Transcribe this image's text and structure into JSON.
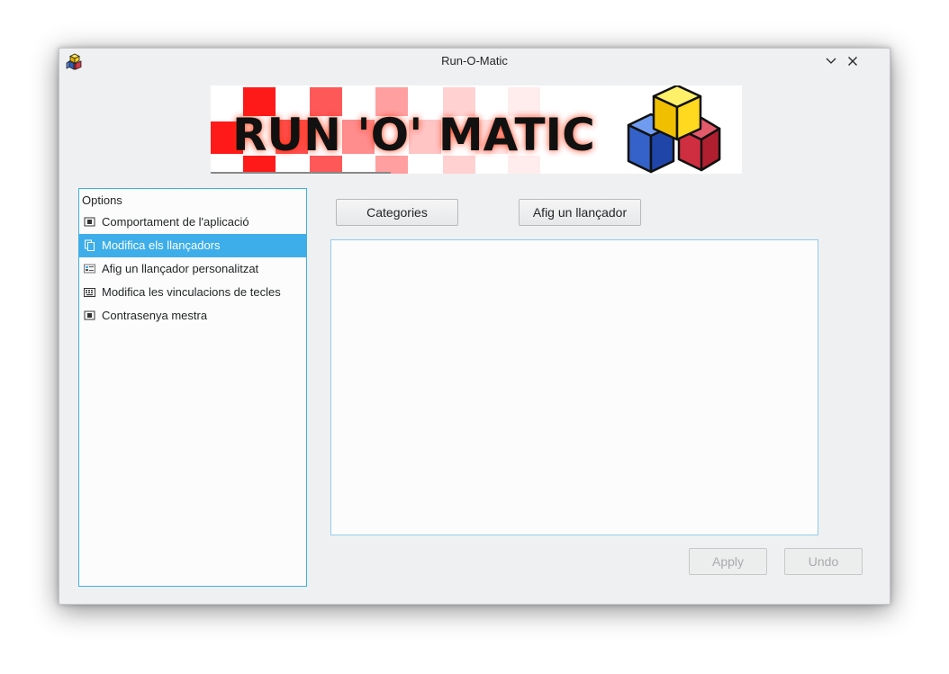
{
  "window": {
    "title": "Run-O-Matic"
  },
  "banner": {
    "text": "RUN 'O' MATIC"
  },
  "options": {
    "header": "Options",
    "items": [
      {
        "label": "Comportament de l'aplicació",
        "icon": "window-icon",
        "selected": false
      },
      {
        "label": "Modifica els llançadors",
        "icon": "copy-icon",
        "selected": true
      },
      {
        "label": "Afig un llançador personalitzat",
        "icon": "launcher-icon",
        "selected": false
      },
      {
        "label": "Modifica les vinculacions de tecles",
        "icon": "keyboard-icon",
        "selected": false
      },
      {
        "label": "Contrasenya mestra",
        "icon": "window-icon",
        "selected": false
      }
    ]
  },
  "toolbar": {
    "categories_label": "Categories",
    "add_launcher_label": "Afig un llançador"
  },
  "footer": {
    "apply_label": "Apply",
    "undo_label": "Undo"
  },
  "colors": {
    "accent": "#3daee9",
    "window_bg": "#eff0f1",
    "panel_bg": "#fcfcfc",
    "text": "#232627",
    "disabled_text": "#a8abad"
  }
}
